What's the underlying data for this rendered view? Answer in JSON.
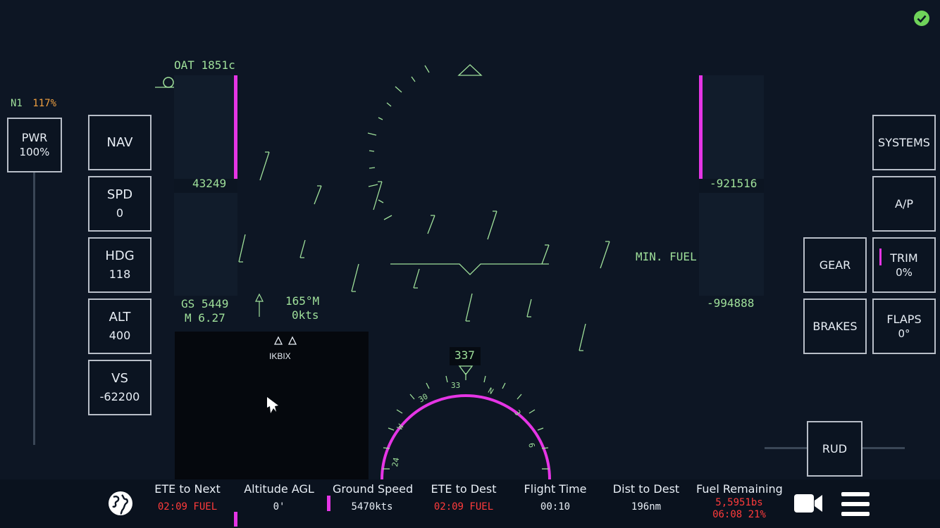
{
  "status_icon": "check-circle-icon",
  "n1": {
    "label": "N1",
    "value": "117%"
  },
  "pwr": {
    "label": "PWR",
    "value": "100%"
  },
  "left_buttons": {
    "nav": {
      "label": "NAV"
    },
    "spd": {
      "label": "SPD",
      "value": "0"
    },
    "hdg": {
      "label": "HDG",
      "value": "118"
    },
    "alt": {
      "label": "ALT",
      "value": "400"
    },
    "vs": {
      "label": "VS",
      "value": "-62200"
    }
  },
  "right_buttons": {
    "systems": {
      "label": "SYSTEMS"
    },
    "ap": {
      "label": "A/P"
    },
    "gear": {
      "label": "GEAR"
    },
    "trim": {
      "label": "TRIM",
      "value": "0%"
    },
    "brakes": {
      "label": "BRAKES"
    },
    "flaps": {
      "label": "FLAPS",
      "value": "0°"
    },
    "rud": {
      "label": "RUD"
    }
  },
  "hud": {
    "oat": "OAT 1851c",
    "speed_tape_value": "43249",
    "alt_tape_value": "-921516",
    "alt_bug": "-994888",
    "gs": "GS 5449",
    "mach": "M 6.27",
    "wind_dir": "165°M",
    "wind_speed": "0kts",
    "min_fuel": "MIN. FUEL",
    "heading": "337"
  },
  "map": {
    "waypoint": "IKBIX"
  },
  "compass": {
    "labels": [
      "33",
      "30",
      "W",
      "24",
      "N",
      "3",
      "6"
    ]
  },
  "bottom": {
    "ete_next": {
      "label": "ETE to Next",
      "value": "02:09 FUEL"
    },
    "alt_agl": {
      "label": "Altitude AGL",
      "value": "0'"
    },
    "ground_speed": {
      "label": "Ground Speed",
      "value": "5470kts"
    },
    "ete_dest": {
      "label": "ETE to Dest",
      "value": "02:09 FUEL"
    },
    "flight_time": {
      "label": "Flight Time",
      "value": "00:10"
    },
    "dist_dest": {
      "label": "Dist to Dest",
      "value": "196nm"
    },
    "fuel": {
      "label": "Fuel Remaining",
      "value1": "5,5951bs",
      "value2": "06:08 21%"
    }
  },
  "colors": {
    "accent": "#e535e5",
    "hud": "#9fe09a",
    "warning": "#ff3b3b",
    "n1": "#f0a040"
  }
}
